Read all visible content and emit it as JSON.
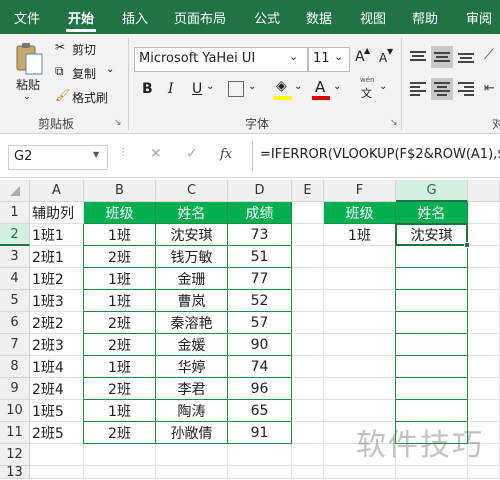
{
  "tabs": [
    "文件",
    "开始",
    "插入",
    "页面布局",
    "公式",
    "数据",
    "视图",
    "帮助",
    "审阅"
  ],
  "ribbon": {
    "paste": "粘贴",
    "cut": "剪切",
    "copy": "复制",
    "format_painter": "格式刷",
    "clipboard_group": "剪贴板",
    "font_name": "Microsoft YaHei UI",
    "font_size": "11",
    "font_group": "字体",
    "align_group_partial": "对",
    "bold": "B",
    "italic": "I",
    "underline": "U",
    "wen": "wén",
    "wen2": "文",
    "font_color_letter": "A",
    "grow_font": "A",
    "shrink_font": "A"
  },
  "formula_bar": {
    "name_box": "G2",
    "fx": "fx",
    "formula": "=IFERROR(VLOOKUP(F$2&ROW(A1),$A"
  },
  "sheet": {
    "columns": [
      "A",
      "B",
      "C",
      "D",
      "E",
      "F",
      "G"
    ],
    "rows": [
      "1",
      "2",
      "3",
      "4",
      "5",
      "6",
      "7",
      "8",
      "9",
      "10",
      "11",
      "12",
      "13"
    ],
    "headers": [
      "辅助列",
      "班级",
      "姓名",
      "成绩"
    ],
    "data": [
      [
        "1班1",
        "1班",
        "沈安琪",
        "73"
      ],
      [
        "2班1",
        "2班",
        "钱万敏",
        "51"
      ],
      [
        "1班2",
        "1班",
        "金珊",
        "77"
      ],
      [
        "1班3",
        "1班",
        "曹岚",
        "52"
      ],
      [
        "2班2",
        "2班",
        "秦溶艳",
        "57"
      ],
      [
        "2班3",
        "2班",
        "金媛",
        "90"
      ],
      [
        "1班4",
        "1班",
        "华婷",
        "74"
      ],
      [
        "2班4",
        "2班",
        "李君",
        "96"
      ],
      [
        "1班5",
        "1班",
        "陶涛",
        "65"
      ],
      [
        "2班5",
        "2班",
        "孙敞倩",
        "91"
      ]
    ],
    "lookup_headers": [
      "班级",
      "姓名"
    ],
    "lookup_value": [
      "1班",
      "沈安琪"
    ]
  },
  "watermark": "软件技巧",
  "colors": {
    "accent": "#217346",
    "header_fill": "#00b050"
  }
}
